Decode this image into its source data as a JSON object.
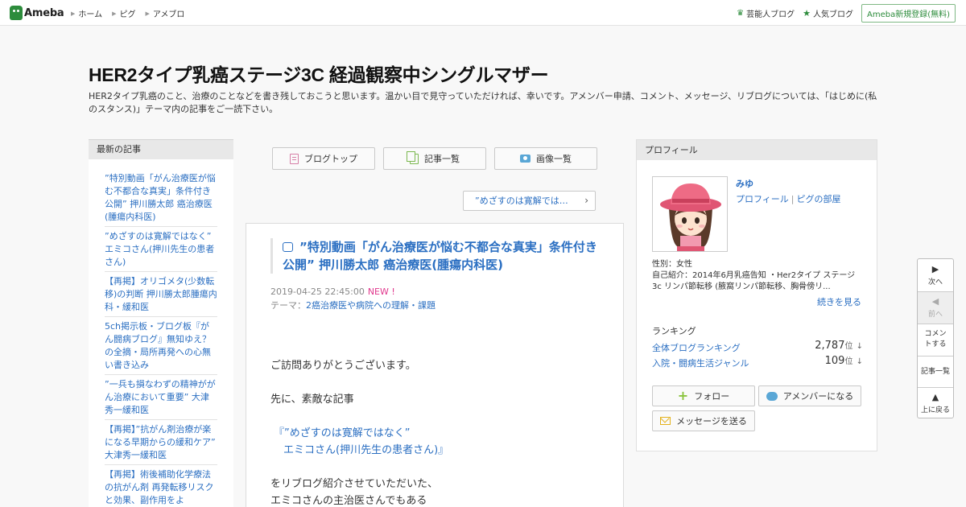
{
  "header": {
    "logo": "Ameba",
    "nav": [
      "ホーム",
      "ピグ",
      "アメブロ"
    ],
    "right_links": {
      "celebrity": "芸能人ブログ",
      "popular": "人気ブログ"
    },
    "register": "Ameba新規登録(無料)"
  },
  "blog": {
    "title": "HER2タイプ乳癌ステージ3C 経過観察中シングルマザー",
    "description": "HER2タイプ乳癌のこと、治療のことなどを書き残しておこうと思います。温かい目で見守っていただければ、幸いです。アメンバー申請、コメント、メッセージ、リブログについては、「はじめに(私のスタンス)」テーマ内の記事をご一読下さい。"
  },
  "recent": {
    "heading": "最新の記事",
    "items": [
      "”特別動画「がん治療医が悩む不都合な真実」条件付き公開” 押川勝太郎 癌治療医(腫瘍内科医)",
      "”めざすのは寛解ではなく” エミコさん(押川先生の患者さん)",
      "【再掲】オリゴメタ(少数転移)の判断 押川勝太郎腫瘍内科・緩和医",
      "5ch掲示板・ブログ板『がん闘病ブログ』無知ゆえ？の全摘・局所再発への心無い書き込み",
      "”一兵も損なわずの精神ががん治療において重要” 大津秀一緩和医",
      "【再掲】”抗がん剤治療が楽になる早期からの緩和ケア” 大津秀一緩和医",
      "【再掲】術後補助化学療法の抗がん剤 再発転移リスクと効果、副作用をよ"
    ]
  },
  "nav_buttons": {
    "top": "ブログトップ",
    "list": "記事一覧",
    "images": "画像一覧"
  },
  "prev_link": "”めざすのは寛解では…",
  "article": {
    "title": "”特別動画「がん治療医が悩む不都合な真実」条件付き公開” 押川勝太郎 癌治療医(腫瘍内科医)",
    "date": "2019-04-25 22:45:00",
    "new_badge": "NEW !",
    "theme_label": "テーマ：",
    "theme": "2癌治療医や病院への理解・課題",
    "body": {
      "p1": "ご訪問ありがとうございます。",
      "p2": "先に、素敵な記事",
      "quote1": "『”めざすのは寛解ではなく”",
      "quote2": "エミコさん(押川先生の患者さん)』",
      "p3": "をリブログ紹介させていただいた、",
      "p4": "エミコさんの主治医さんでもある"
    }
  },
  "profile": {
    "heading": "プロフィール",
    "name": "みゆ",
    "link_profile": "プロフィール",
    "link_pig": "ピグの部屋",
    "gender": "性別：女性",
    "intro": "自己紹介：2014年6月乳癌告知 ・Her2タイプ ステージ3c リンパ節転移 (腋窩リンパ節転移、胸骨傍リ...",
    "more": "続きを見る",
    "ranking_heading": "ランキング",
    "rank1_label": "全体ブログランキング",
    "rank1_value": "2,787",
    "rank2_label": "入院・闘病生活ジャンル",
    "rank2_value": "109",
    "rank_unit": "位",
    "rank_arrow": "↓",
    "follow": "フォロー",
    "amember": "アメンバーになる",
    "message": "メッセージを送る"
  },
  "sidenav": {
    "next": "次へ",
    "prev": "前へ",
    "comment": "コメントする",
    "list": "記事一覧",
    "top": "上に戻る"
  },
  "colors": {
    "link": "#2b6fc2",
    "brand": "#2d8c3c",
    "new": "#e0368c"
  }
}
